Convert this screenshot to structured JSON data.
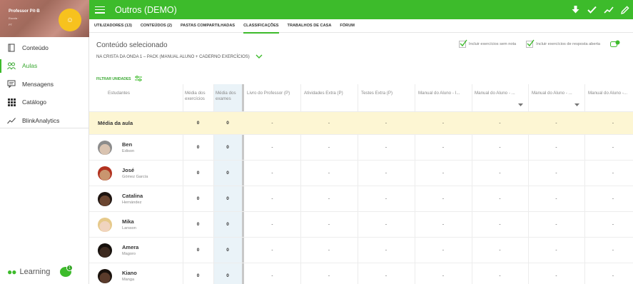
{
  "app": {
    "title": "Outros (DEMO)",
    "accent_color": "#3dbb2b",
    "brand": "Learning"
  },
  "profile": {
    "name": "Professor Pit·B",
    "line1": "Escola ·",
    "line2": "PT"
  },
  "sidebar": {
    "items": [
      {
        "label": "Conteúdo",
        "icon": "book-icon"
      },
      {
        "label": "Aulas",
        "icon": "people-icon"
      },
      {
        "label": "Mensagens",
        "icon": "message-icon"
      },
      {
        "label": "Catálogo",
        "icon": "grid-icon"
      },
      {
        "label": "BlinkAnalytics",
        "icon": "analytics-icon"
      }
    ],
    "chat_badge": "1"
  },
  "tabs": [
    {
      "label": "UTILIZADORES (13)"
    },
    {
      "label": "CONTEÚDOS (2)"
    },
    {
      "label": "PASTAS COMPARTILHADAS"
    },
    {
      "label": "CLASSIFICAÇÕES"
    },
    {
      "label": "TRABALHOS DE CASA"
    },
    {
      "label": "FÓRUM"
    }
  ],
  "content": {
    "label": "Conteúdo selecionado",
    "selected": "NA CRISTA DA ONDA 1 – PACK (MANUAL ALUNO + CADERNO EXERCÍCIOS)",
    "filter_label": "FILTRAR UNIDADES"
  },
  "options": {
    "include_ungraded": "Incluir exercícios sem nota",
    "include_open": "Incluir exercícios de resposta aberta"
  },
  "grid": {
    "headers": {
      "students": "Estudantes",
      "avg_exercises": "Média dos exercícios",
      "avg_exams": "Média dos exames"
    },
    "columns": [
      "Livro do Professor (P)",
      "Atividades Extra (P)",
      "Testes Extra (P)",
      "Manual do Aluno - I...",
      "Manual do Aluno - ...",
      "Manual do Aluno - ...",
      "Manual do Aluno -..."
    ],
    "average_row": {
      "label": "Média da aula",
      "exercises": "0",
      "exams": "0",
      "values": [
        "-",
        "-",
        "-",
        "-",
        "-",
        "-",
        "-"
      ]
    },
    "students": [
      {
        "first": "Ben",
        "last": "Edison",
        "exercises": "0",
        "exams": "0",
        "values": [
          "-",
          "-",
          "-",
          "-",
          "-",
          "-",
          "-"
        ]
      },
      {
        "first": "José",
        "last": "Gómez García",
        "exercises": "0",
        "exams": "0",
        "values": [
          "-",
          "-",
          "-",
          "-",
          "-",
          "-",
          "-"
        ]
      },
      {
        "first": "Catalina",
        "last": "Hernández",
        "exercises": "0",
        "exams": "0",
        "values": [
          "-",
          "-",
          "-",
          "-",
          "-",
          "-",
          "-"
        ]
      },
      {
        "first": "Mika",
        "last": "Larsson",
        "exercises": "0",
        "exams": "0",
        "values": [
          "-",
          "-",
          "-",
          "-",
          "-",
          "-",
          "-"
        ]
      },
      {
        "first": "Amera",
        "last": "Magoro",
        "exercises": "0",
        "exams": "0",
        "values": [
          "-",
          "-",
          "-",
          "-",
          "-",
          "-",
          "-"
        ]
      },
      {
        "first": "Kiano",
        "last": "Manga",
        "exercises": "0",
        "exams": "0",
        "values": [
          "-",
          "-",
          "-",
          "-",
          "-",
          "-",
          "-"
        ]
      }
    ]
  }
}
